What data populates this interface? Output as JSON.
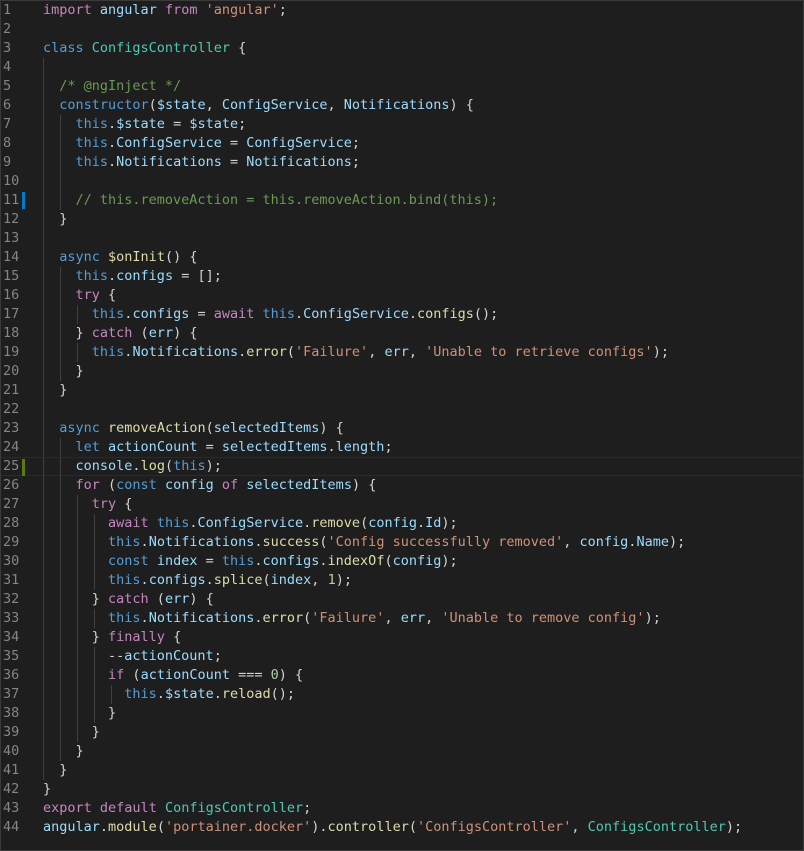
{
  "editor": {
    "language": "javascript",
    "file_lines": [
      {
        "n": "1",
        "indent": 0,
        "tokens": [
          [
            "ctl",
            "import"
          ],
          [
            "plain",
            " "
          ],
          [
            "var",
            "angular"
          ],
          [
            "plain",
            " "
          ],
          [
            "ctl",
            "from"
          ],
          [
            "plain",
            " "
          ],
          [
            "str",
            "'angular'"
          ],
          [
            "plain",
            ";"
          ]
        ]
      },
      {
        "n": "2",
        "indent": 0,
        "tokens": []
      },
      {
        "n": "3",
        "indent": 0,
        "tokens": [
          [
            "kw",
            "class"
          ],
          [
            "plain",
            " "
          ],
          [
            "cls",
            "ConfigsController"
          ],
          [
            "plain",
            " {"
          ]
        ]
      },
      {
        "n": "4",
        "indent": 1,
        "tokens": []
      },
      {
        "n": "5",
        "indent": 1,
        "tokens": [
          [
            "plain",
            "  "
          ],
          [
            "cmt",
            "/* @ngInject */"
          ]
        ]
      },
      {
        "n": "6",
        "indent": 1,
        "tokens": [
          [
            "plain",
            "  "
          ],
          [
            "kw",
            "constructor"
          ],
          [
            "plain",
            "("
          ],
          [
            "var",
            "$state"
          ],
          [
            "plain",
            ", "
          ],
          [
            "var",
            "ConfigService"
          ],
          [
            "plain",
            ", "
          ],
          [
            "var",
            "Notifications"
          ],
          [
            "plain",
            ") {"
          ]
        ]
      },
      {
        "n": "7",
        "indent": 2,
        "tokens": [
          [
            "plain",
            "    "
          ],
          [
            "kw",
            "this"
          ],
          [
            "plain",
            "."
          ],
          [
            "var",
            "$state"
          ],
          [
            "plain",
            " = "
          ],
          [
            "var",
            "$state"
          ],
          [
            "plain",
            ";"
          ]
        ]
      },
      {
        "n": "8",
        "indent": 2,
        "tokens": [
          [
            "plain",
            "    "
          ],
          [
            "kw",
            "this"
          ],
          [
            "plain",
            "."
          ],
          [
            "var",
            "ConfigService"
          ],
          [
            "plain",
            " = "
          ],
          [
            "var",
            "ConfigService"
          ],
          [
            "plain",
            ";"
          ]
        ]
      },
      {
        "n": "9",
        "indent": 2,
        "tokens": [
          [
            "plain",
            "    "
          ],
          [
            "kw",
            "this"
          ],
          [
            "plain",
            "."
          ],
          [
            "var",
            "Notifications"
          ],
          [
            "plain",
            " = "
          ],
          [
            "var",
            "Notifications"
          ],
          [
            "plain",
            ";"
          ]
        ]
      },
      {
        "n": "10",
        "indent": 2,
        "tokens": []
      },
      {
        "n": "11",
        "indent": 2,
        "marker": "#007acc",
        "tokens": [
          [
            "plain",
            "    "
          ],
          [
            "cmt",
            "// this.removeAction = this.removeAction.bind(this);"
          ]
        ]
      },
      {
        "n": "12",
        "indent": 1,
        "tokens": [
          [
            "plain",
            "  }"
          ]
        ]
      },
      {
        "n": "13",
        "indent": 1,
        "tokens": []
      },
      {
        "n": "14",
        "indent": 1,
        "tokens": [
          [
            "plain",
            "  "
          ],
          [
            "kw",
            "async"
          ],
          [
            "plain",
            " "
          ],
          [
            "fn",
            "$onInit"
          ],
          [
            "plain",
            "() {"
          ]
        ]
      },
      {
        "n": "15",
        "indent": 2,
        "tokens": [
          [
            "plain",
            "    "
          ],
          [
            "kw",
            "this"
          ],
          [
            "plain",
            "."
          ],
          [
            "var",
            "configs"
          ],
          [
            "plain",
            " = [];"
          ]
        ]
      },
      {
        "n": "16",
        "indent": 2,
        "tokens": [
          [
            "plain",
            "    "
          ],
          [
            "ctl",
            "try"
          ],
          [
            "plain",
            " {"
          ]
        ]
      },
      {
        "n": "17",
        "indent": 3,
        "tokens": [
          [
            "plain",
            "      "
          ],
          [
            "kw",
            "this"
          ],
          [
            "plain",
            "."
          ],
          [
            "var",
            "configs"
          ],
          [
            "plain",
            " = "
          ],
          [
            "ctl",
            "await"
          ],
          [
            "plain",
            " "
          ],
          [
            "kw",
            "this"
          ],
          [
            "plain",
            "."
          ],
          [
            "var",
            "ConfigService"
          ],
          [
            "plain",
            "."
          ],
          [
            "fn",
            "configs"
          ],
          [
            "plain",
            "();"
          ]
        ]
      },
      {
        "n": "18",
        "indent": 2,
        "tokens": [
          [
            "plain",
            "    } "
          ],
          [
            "ctl",
            "catch"
          ],
          [
            "plain",
            " ("
          ],
          [
            "var",
            "err"
          ],
          [
            "plain",
            ") {"
          ]
        ]
      },
      {
        "n": "19",
        "indent": 3,
        "tokens": [
          [
            "plain",
            "      "
          ],
          [
            "kw",
            "this"
          ],
          [
            "plain",
            "."
          ],
          [
            "var",
            "Notifications"
          ],
          [
            "plain",
            "."
          ],
          [
            "fn",
            "error"
          ],
          [
            "plain",
            "("
          ],
          [
            "str",
            "'Failure'"
          ],
          [
            "plain",
            ", "
          ],
          [
            "var",
            "err"
          ],
          [
            "plain",
            ", "
          ],
          [
            "str",
            "'Unable to retrieve configs'"
          ],
          [
            "plain",
            ");"
          ]
        ]
      },
      {
        "n": "20",
        "indent": 2,
        "tokens": [
          [
            "plain",
            "    }"
          ]
        ]
      },
      {
        "n": "21",
        "indent": 1,
        "tokens": [
          [
            "plain",
            "  }"
          ]
        ]
      },
      {
        "n": "22",
        "indent": 1,
        "tokens": []
      },
      {
        "n": "23",
        "indent": 1,
        "tokens": [
          [
            "plain",
            "  "
          ],
          [
            "kw",
            "async"
          ],
          [
            "plain",
            " "
          ],
          [
            "fn",
            "removeAction"
          ],
          [
            "plain",
            "("
          ],
          [
            "var",
            "selectedItems"
          ],
          [
            "plain",
            ") {"
          ]
        ]
      },
      {
        "n": "24",
        "indent": 2,
        "tokens": [
          [
            "plain",
            "    "
          ],
          [
            "kw",
            "let"
          ],
          [
            "plain",
            " "
          ],
          [
            "var",
            "actionCount"
          ],
          [
            "plain",
            " = "
          ],
          [
            "var",
            "selectedItems"
          ],
          [
            "plain",
            "."
          ],
          [
            "var",
            "length"
          ],
          [
            "plain",
            ";"
          ]
        ]
      },
      {
        "n": "25",
        "indent": 2,
        "marker": "#587c0c",
        "current": true,
        "tokens": [
          [
            "plain",
            "    "
          ],
          [
            "var",
            "console"
          ],
          [
            "plain",
            "."
          ],
          [
            "fn",
            "log"
          ],
          [
            "plain",
            "("
          ],
          [
            "kw",
            "this"
          ],
          [
            "plain",
            ");"
          ]
        ]
      },
      {
        "n": "26",
        "indent": 2,
        "tokens": [
          [
            "plain",
            "    "
          ],
          [
            "ctl",
            "for"
          ],
          [
            "plain",
            " ("
          ],
          [
            "kw",
            "const"
          ],
          [
            "plain",
            " "
          ],
          [
            "var",
            "config"
          ],
          [
            "plain",
            " "
          ],
          [
            "ctl",
            "of"
          ],
          [
            "plain",
            " "
          ],
          [
            "var",
            "selectedItems"
          ],
          [
            "plain",
            ") {"
          ]
        ]
      },
      {
        "n": "27",
        "indent": 3,
        "tokens": [
          [
            "plain",
            "      "
          ],
          [
            "ctl",
            "try"
          ],
          [
            "plain",
            " {"
          ]
        ]
      },
      {
        "n": "28",
        "indent": 4,
        "tokens": [
          [
            "plain",
            "        "
          ],
          [
            "ctl",
            "await"
          ],
          [
            "plain",
            " "
          ],
          [
            "kw",
            "this"
          ],
          [
            "plain",
            "."
          ],
          [
            "var",
            "ConfigService"
          ],
          [
            "plain",
            "."
          ],
          [
            "fn",
            "remove"
          ],
          [
            "plain",
            "("
          ],
          [
            "var",
            "config"
          ],
          [
            "plain",
            "."
          ],
          [
            "var",
            "Id"
          ],
          [
            "plain",
            ");"
          ]
        ]
      },
      {
        "n": "29",
        "indent": 4,
        "tokens": [
          [
            "plain",
            "        "
          ],
          [
            "kw",
            "this"
          ],
          [
            "plain",
            "."
          ],
          [
            "var",
            "Notifications"
          ],
          [
            "plain",
            "."
          ],
          [
            "fn",
            "success"
          ],
          [
            "plain",
            "("
          ],
          [
            "str",
            "'Config successfully removed'"
          ],
          [
            "plain",
            ", "
          ],
          [
            "var",
            "config"
          ],
          [
            "plain",
            "."
          ],
          [
            "var",
            "Name"
          ],
          [
            "plain",
            ");"
          ]
        ]
      },
      {
        "n": "30",
        "indent": 4,
        "tokens": [
          [
            "plain",
            "        "
          ],
          [
            "kw",
            "const"
          ],
          [
            "plain",
            " "
          ],
          [
            "var",
            "index"
          ],
          [
            "plain",
            " = "
          ],
          [
            "kw",
            "this"
          ],
          [
            "plain",
            "."
          ],
          [
            "var",
            "configs"
          ],
          [
            "plain",
            "."
          ],
          [
            "fn",
            "indexOf"
          ],
          [
            "plain",
            "("
          ],
          [
            "var",
            "config"
          ],
          [
            "plain",
            ");"
          ]
        ]
      },
      {
        "n": "31",
        "indent": 4,
        "tokens": [
          [
            "plain",
            "        "
          ],
          [
            "kw",
            "this"
          ],
          [
            "plain",
            "."
          ],
          [
            "var",
            "configs"
          ],
          [
            "plain",
            "."
          ],
          [
            "fn",
            "splice"
          ],
          [
            "plain",
            "("
          ],
          [
            "var",
            "index"
          ],
          [
            "plain",
            ", "
          ],
          [
            "num",
            "1"
          ],
          [
            "plain",
            ");"
          ]
        ]
      },
      {
        "n": "32",
        "indent": 3,
        "tokens": [
          [
            "plain",
            "      } "
          ],
          [
            "ctl",
            "catch"
          ],
          [
            "plain",
            " ("
          ],
          [
            "var",
            "err"
          ],
          [
            "plain",
            ") {"
          ]
        ]
      },
      {
        "n": "33",
        "indent": 4,
        "tokens": [
          [
            "plain",
            "        "
          ],
          [
            "kw",
            "this"
          ],
          [
            "plain",
            "."
          ],
          [
            "var",
            "Notifications"
          ],
          [
            "plain",
            "."
          ],
          [
            "fn",
            "error"
          ],
          [
            "plain",
            "("
          ],
          [
            "str",
            "'Failure'"
          ],
          [
            "plain",
            ", "
          ],
          [
            "var",
            "err"
          ],
          [
            "plain",
            ", "
          ],
          [
            "str",
            "'Unable to remove config'"
          ],
          [
            "plain",
            ");"
          ]
        ]
      },
      {
        "n": "34",
        "indent": 3,
        "tokens": [
          [
            "plain",
            "      } "
          ],
          [
            "ctl",
            "finally"
          ],
          [
            "plain",
            " {"
          ]
        ]
      },
      {
        "n": "35",
        "indent": 4,
        "tokens": [
          [
            "plain",
            "        --"
          ],
          [
            "var",
            "actionCount"
          ],
          [
            "plain",
            ";"
          ]
        ]
      },
      {
        "n": "36",
        "indent": 4,
        "tokens": [
          [
            "plain",
            "        "
          ],
          [
            "ctl",
            "if"
          ],
          [
            "plain",
            " ("
          ],
          [
            "var",
            "actionCount"
          ],
          [
            "plain",
            " === "
          ],
          [
            "num",
            "0"
          ],
          [
            "plain",
            ") {"
          ]
        ]
      },
      {
        "n": "37",
        "indent": 5,
        "tokens": [
          [
            "plain",
            "          "
          ],
          [
            "kw",
            "this"
          ],
          [
            "plain",
            "."
          ],
          [
            "var",
            "$state"
          ],
          [
            "plain",
            "."
          ],
          [
            "fn",
            "reload"
          ],
          [
            "plain",
            "();"
          ]
        ]
      },
      {
        "n": "38",
        "indent": 4,
        "tokens": [
          [
            "plain",
            "        }"
          ]
        ]
      },
      {
        "n": "39",
        "indent": 3,
        "tokens": [
          [
            "plain",
            "      }"
          ]
        ]
      },
      {
        "n": "40",
        "indent": 2,
        "tokens": [
          [
            "plain",
            "    }"
          ]
        ]
      },
      {
        "n": "41",
        "indent": 1,
        "tokens": [
          [
            "plain",
            "  }"
          ]
        ]
      },
      {
        "n": "42",
        "indent": 0,
        "tokens": [
          [
            "plain",
            "}"
          ]
        ]
      },
      {
        "n": "43",
        "indent": 0,
        "tokens": [
          [
            "ctl",
            "export"
          ],
          [
            "plain",
            " "
          ],
          [
            "ctl",
            "default"
          ],
          [
            "plain",
            " "
          ],
          [
            "cls",
            "ConfigsController"
          ],
          [
            "plain",
            ";"
          ]
        ]
      },
      {
        "n": "44",
        "indent": 0,
        "tokens": [
          [
            "var",
            "angular"
          ],
          [
            "plain",
            "."
          ],
          [
            "fn",
            "module"
          ],
          [
            "plain",
            "("
          ],
          [
            "str",
            "'portainer.docker'"
          ],
          [
            "plain",
            ")."
          ],
          [
            "fn",
            "controller"
          ],
          [
            "plain",
            "("
          ],
          [
            "str",
            "'ConfigsController'"
          ],
          [
            "plain",
            ", "
          ],
          [
            "cls",
            "ConfigsController"
          ],
          [
            "plain",
            ");"
          ]
        ]
      }
    ]
  }
}
